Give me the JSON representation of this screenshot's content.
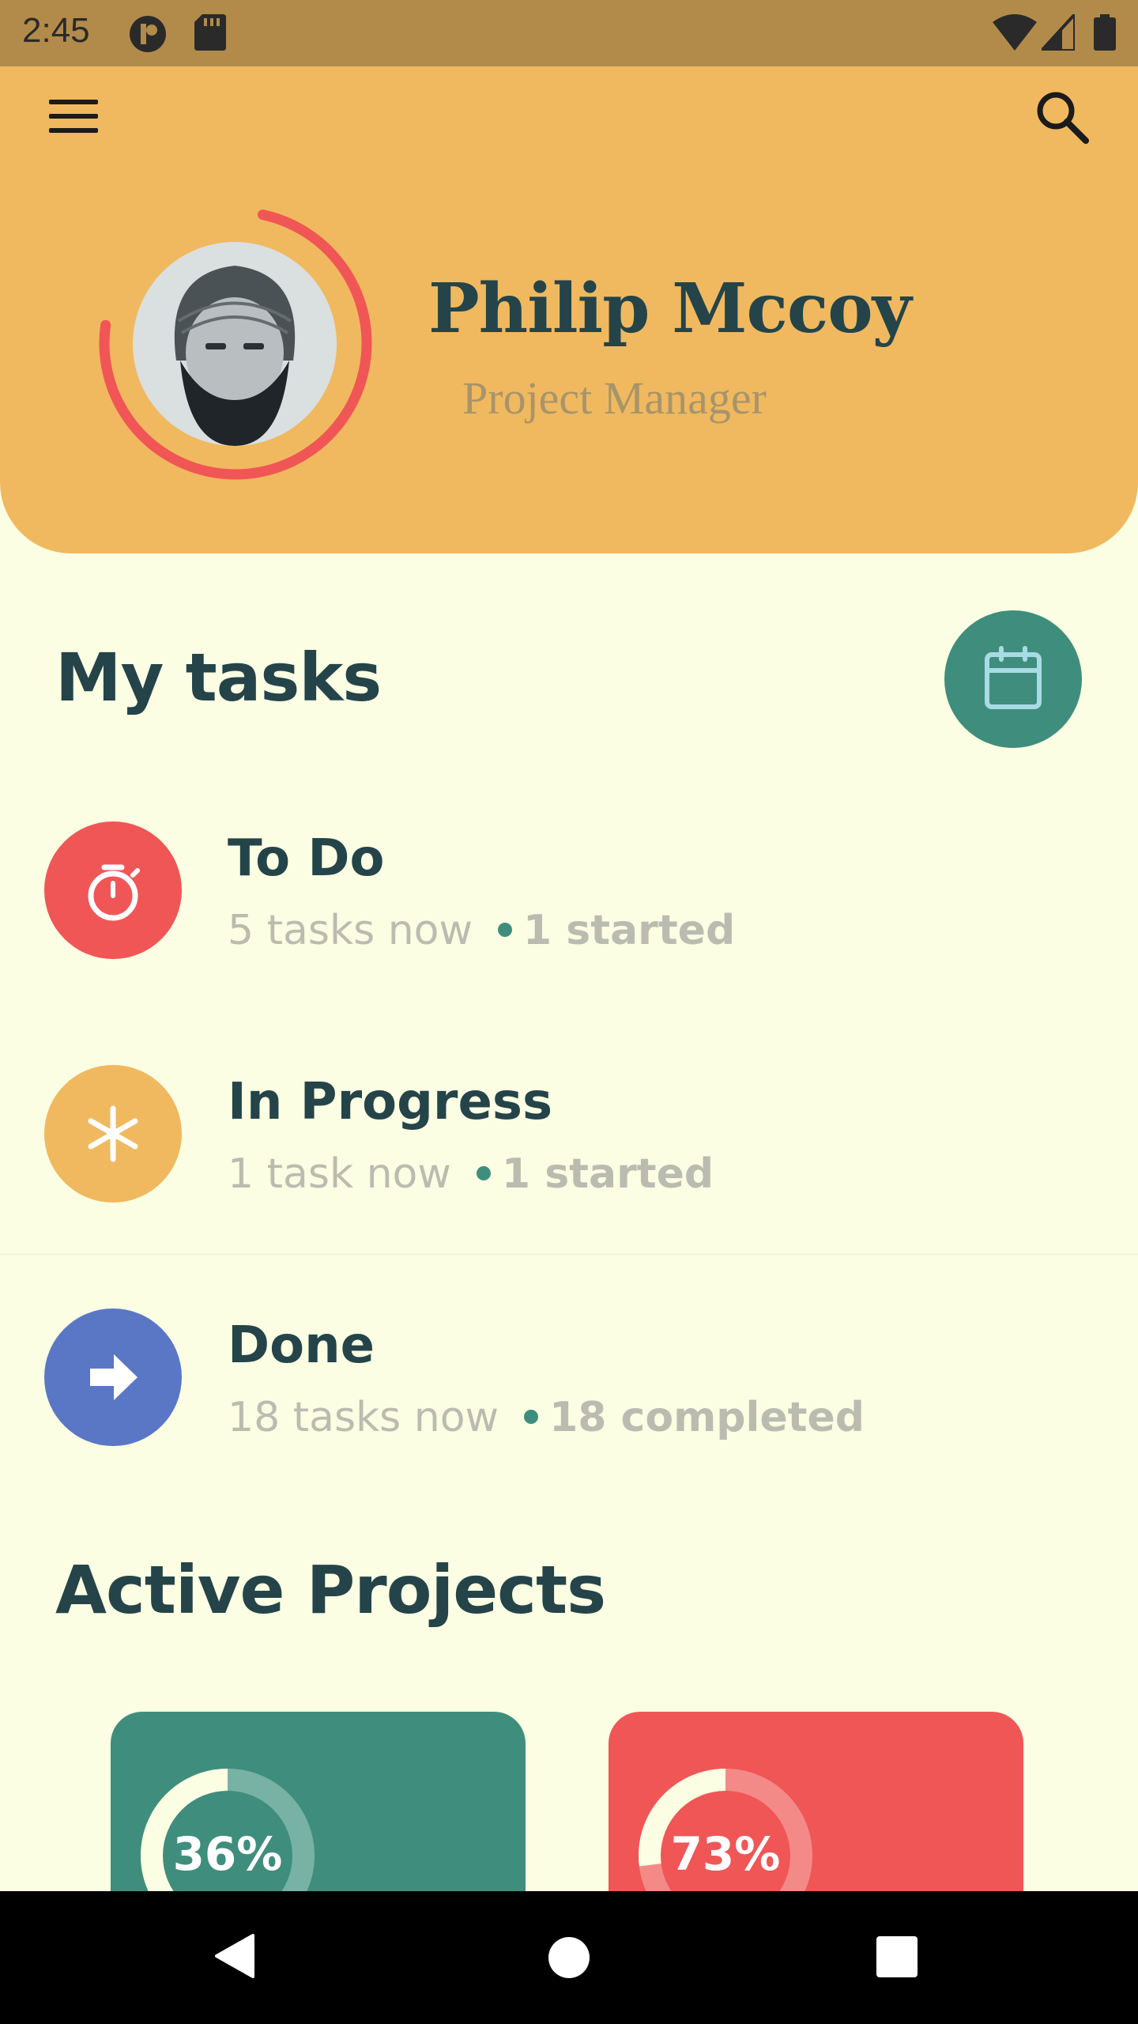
{
  "status_bar": {
    "time": "2:45"
  },
  "profile": {
    "name": "Philip Mccoy",
    "role": "Project Manager"
  },
  "my_tasks": {
    "title": "My tasks",
    "items": [
      {
        "title": "To Do",
        "count_text": "5 tasks now",
        "status_text": "1 started",
        "icon": "stopwatch-icon",
        "color": "#F05656"
      },
      {
        "title": "In Progress",
        "count_text": "1 task now",
        "status_text": "1 started",
        "icon": "snowflake-icon",
        "color": "#F0B95F"
      },
      {
        "title": "Done",
        "count_text": "18 tasks now",
        "status_text": "18 completed",
        "icon": "arrow-right-icon",
        "color": "#5A77C6"
      }
    ]
  },
  "active_projects": {
    "title": "Active Projects",
    "items": [
      {
        "percent_label": "36%",
        "progress": 0.36,
        "color": "#3F8E7D"
      },
      {
        "percent_label": "73%",
        "progress": 0.73,
        "color": "#F05656"
      }
    ]
  },
  "colors": {
    "header": "#F0B95F",
    "background": "#FBFEE2",
    "text_dark": "#24444A",
    "accent_green": "#3F8E7D",
    "accent_red": "#F05656",
    "accent_blue": "#5A77C6"
  }
}
